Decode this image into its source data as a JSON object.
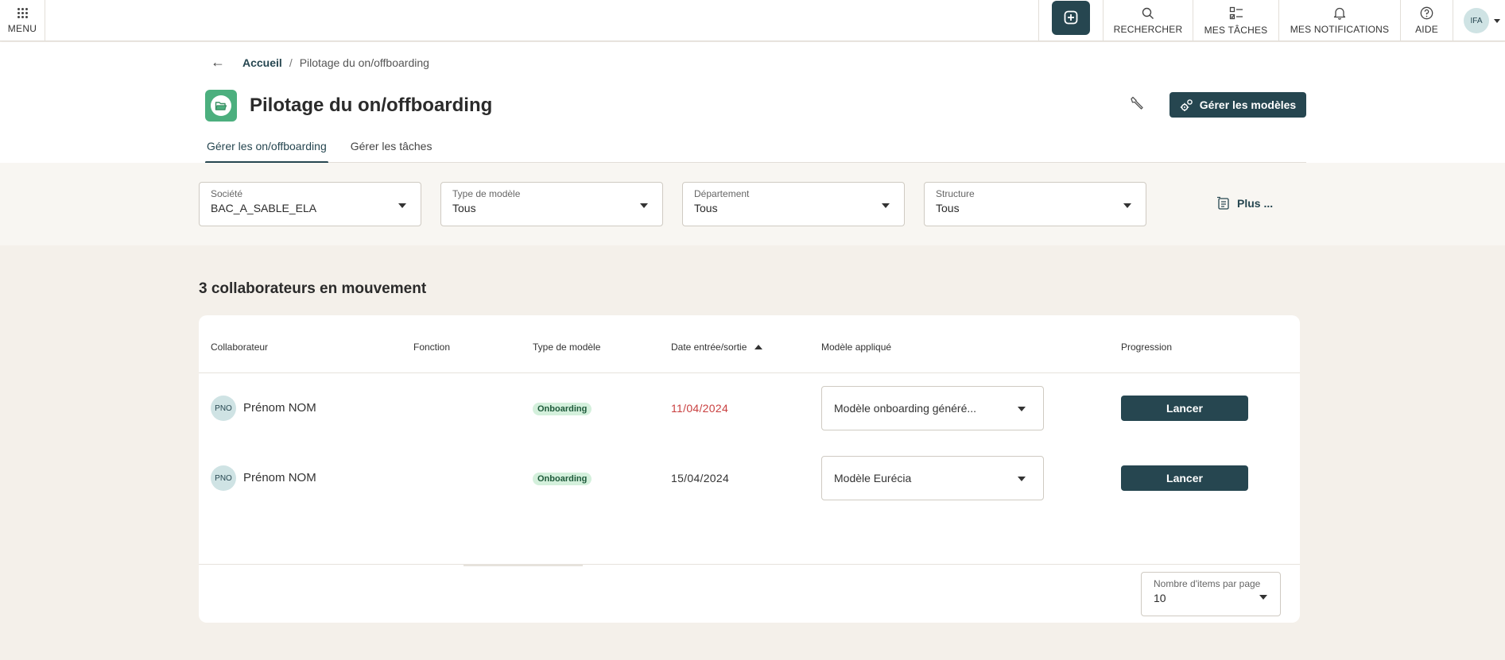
{
  "topbar": {
    "menu_label": "MENU",
    "nav": [
      {
        "label": "RECHERCHER",
        "icon": "search-icon"
      },
      {
        "label": "MES TÂCHES",
        "icon": "tasks-icon"
      },
      {
        "label": "MES NOTIFICATIONS",
        "icon": "bell-icon"
      },
      {
        "label": "AIDE",
        "icon": "help-icon"
      }
    ],
    "avatar_initials": "IFA"
  },
  "breadcrumb": {
    "home": "Accueil",
    "separator": "/",
    "current": "Pilotage du on/offboarding"
  },
  "header": {
    "title": "Pilotage du on/offboarding",
    "manage_button": "Gérer les modèles"
  },
  "tabs": [
    {
      "label": "Gérer les on/offboarding",
      "active": true
    },
    {
      "label": "Gérer les tâches",
      "active": false
    }
  ],
  "filters": [
    {
      "label": "Société",
      "value": "BAC_A_SABLE_ELA"
    },
    {
      "label": "Type de modèle",
      "value": "Tous"
    },
    {
      "label": "Département",
      "value": "Tous"
    },
    {
      "label": "Structure",
      "value": "Tous"
    }
  ],
  "more_label": "Plus ...",
  "count_title": "3 collaborateurs en mouvement",
  "table": {
    "columns": [
      "Collaborateur",
      "Fonction",
      "Type de modèle",
      "Date entrée/sortie",
      "Modèle appliqué",
      "Progression"
    ],
    "sorted_column": "Date entrée/sortie",
    "rows": [
      {
        "initials": "PNO",
        "name": "Prénom NOM",
        "fonction": "",
        "type": "Onboarding",
        "date": "11/04/2024",
        "date_overdue": true,
        "model": "Modèle onboarding généré...",
        "action": "Lancer"
      },
      {
        "initials": "PNO",
        "name": "Prénom NOM",
        "fonction": "",
        "type": "Onboarding",
        "date": "15/04/2024",
        "date_overdue": false,
        "model": "Modèle Eurécia",
        "action": "Lancer"
      }
    ]
  },
  "pagination": {
    "label": "Nombre d'items par page",
    "value": "10"
  },
  "colors": {
    "primary": "#264650",
    "background": "#f4f0ea",
    "overdue": "#c94040",
    "badge_bg": "#d4f0dc",
    "title_icon": "#4caf7e"
  }
}
